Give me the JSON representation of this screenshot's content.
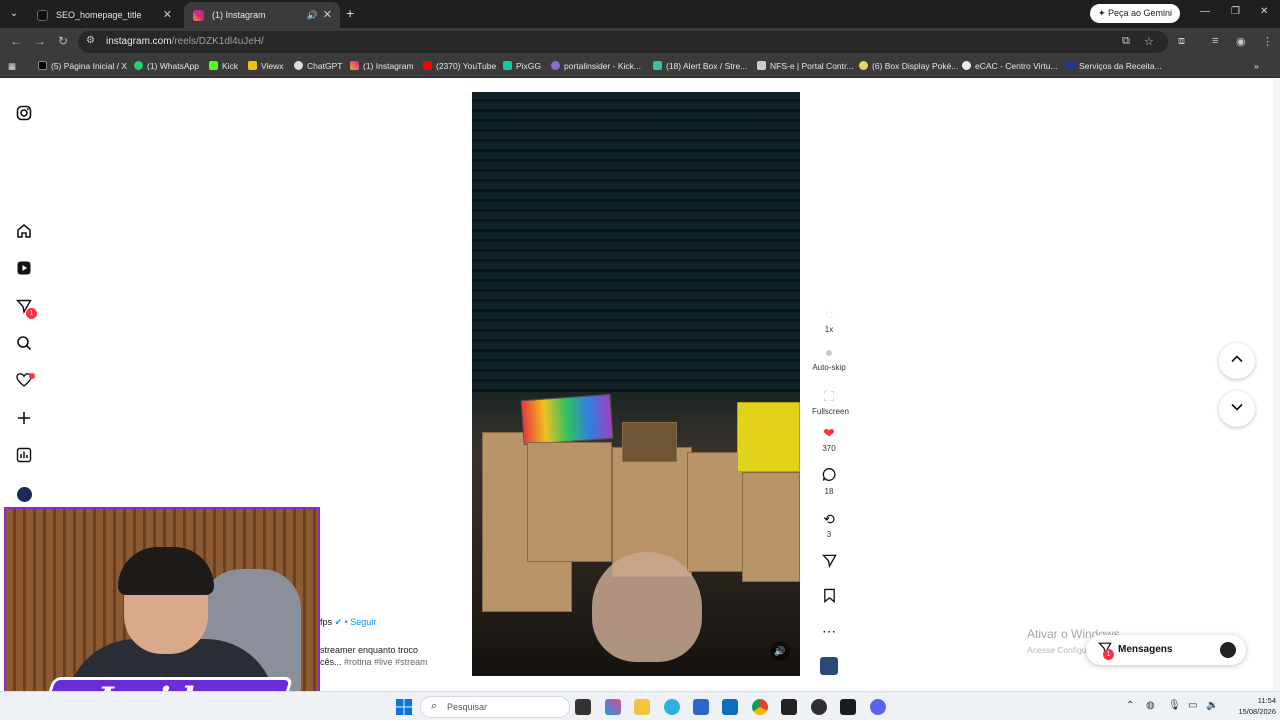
{
  "browser": {
    "tabs": [
      {
        "title": "SEO_homepage_title",
        "active": false
      },
      {
        "title": "(1) Instagram",
        "active": true
      }
    ],
    "gemini_button": "Peça ao Gemini",
    "url_host": "instagram.com",
    "url_path": "/reels/DZK1dl4uJeH/",
    "bookmarks": [
      "(5) Página Inicial / X",
      "(1) WhatsApp",
      "Kick",
      "Viewx",
      "ChatGPT",
      "(1) Instagram",
      "(2370) YouTube",
      "PixGG",
      "portalinsider - Kick...",
      "(18) Alert Box / Stre...",
      "NFS-e | Portal Contr...",
      "(6) Box Display Poké...",
      "eCAC - Centro Virtu...",
      "Serviços da Receita..."
    ]
  },
  "sidebar": {
    "notifications_badge": "1"
  },
  "reel": {
    "speed_label": "1x",
    "autoskip_label": "Auto-skip",
    "fullscreen_label": "Fullscreen",
    "likes": "370",
    "comments": "18",
    "reposts": "3",
    "author_suffix": "fps",
    "follow_label": "• Seguir",
    "caption_text": "streamer enquanto troco",
    "caption_more": "cês...",
    "caption_tags": "#rotina #live #stream"
  },
  "messages": {
    "label": "Mensagens",
    "badge": "1"
  },
  "watermark": {
    "line1": "Ativar o Windows",
    "line2": "Acesse Configurações para ativar o Windows."
  },
  "overlay": {
    "logo_text": "Insider"
  },
  "taskbar": {
    "search_placeholder": "Pesquisar",
    "time": "11:54",
    "date": "15/08/2026"
  },
  "colors": {
    "like_red": "#ff3040",
    "follow_blue": "#0095f6",
    "overlay_purple": "#6a2bd9"
  }
}
